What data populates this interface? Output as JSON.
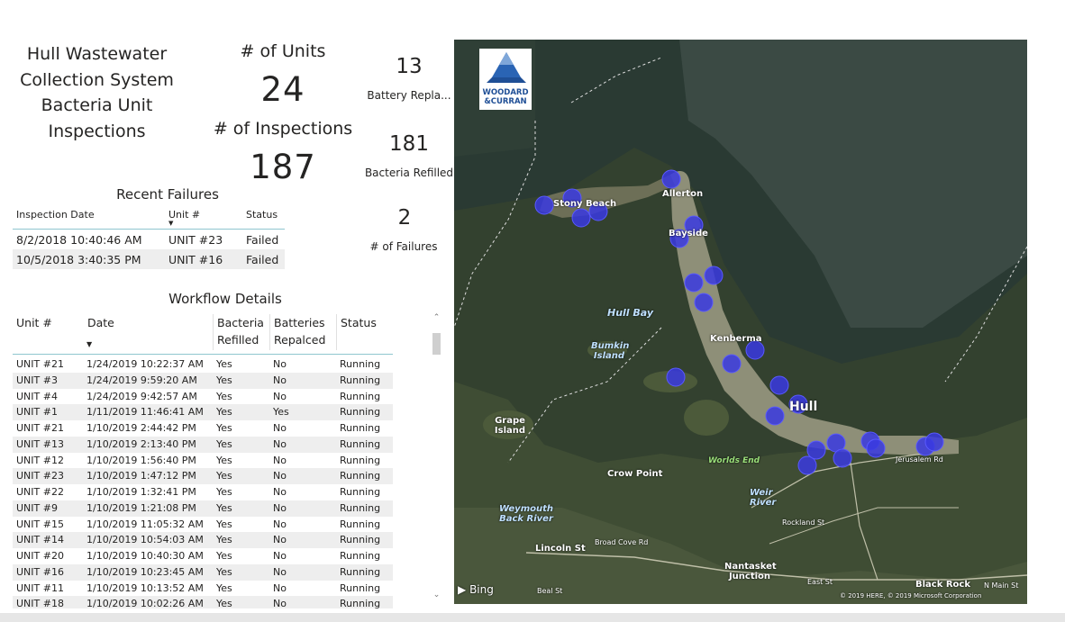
{
  "header": {
    "title": "Hull Wastewater Collection System Bacteria Unit Inspections"
  },
  "cards": {
    "units_label": "# of Units",
    "units_value": "24",
    "inspections_label": "# of Inspections",
    "inspections_value": "187"
  },
  "kpis": [
    {
      "value": "13",
      "label": "Battery Repla..."
    },
    {
      "value": "181",
      "label": "Bacteria Refilled"
    },
    {
      "value": "2",
      "label": "# of Failures"
    }
  ],
  "recent_failures": {
    "title": "Recent Failures",
    "columns": [
      "Inspection Date",
      "Unit #",
      "Status"
    ],
    "rows": [
      [
        "8/2/2018 10:40:46 AM",
        "UNIT #23",
        "Failed"
      ],
      [
        "10/5/2018 3:40:35 PM",
        "UNIT #16",
        "Failed"
      ]
    ]
  },
  "workflow": {
    "title": "Workflow Details",
    "columns": [
      "Unit #",
      "Date",
      "Bacteria Refilled",
      "Batteries Repalced",
      "Status"
    ],
    "rows": [
      [
        "UNIT #21",
        "1/24/2019 10:22:37 AM",
        "Yes",
        "No",
        "Running"
      ],
      [
        "UNIT #3",
        "1/24/2019 9:59:20 AM",
        "Yes",
        "No",
        "Running"
      ],
      [
        "UNIT #4",
        "1/24/2019 9:42:57 AM",
        "Yes",
        "No",
        "Running"
      ],
      [
        "UNIT #1",
        "1/11/2019 11:46:41 AM",
        "Yes",
        "Yes",
        "Running"
      ],
      [
        "UNIT #21",
        "1/10/2019 2:44:42 PM",
        "Yes",
        "No",
        "Running"
      ],
      [
        "UNIT #13",
        "1/10/2019 2:13:40 PM",
        "Yes",
        "No",
        "Running"
      ],
      [
        "UNIT #12",
        "1/10/2019 1:56:40 PM",
        "Yes",
        "No",
        "Running"
      ],
      [
        "UNIT #23",
        "1/10/2019 1:47:12 PM",
        "Yes",
        "No",
        "Running"
      ],
      [
        "UNIT #22",
        "1/10/2019 1:32:41 PM",
        "Yes",
        "No",
        "Running"
      ],
      [
        "UNIT #9",
        "1/10/2019 1:21:08 PM",
        "Yes",
        "No",
        "Running"
      ],
      [
        "UNIT #15",
        "1/10/2019 11:05:32 AM",
        "Yes",
        "No",
        "Running"
      ],
      [
        "UNIT #14",
        "1/10/2019 10:54:03 AM",
        "Yes",
        "No",
        "Running"
      ],
      [
        "UNIT #20",
        "1/10/2019 10:40:30 AM",
        "Yes",
        "No",
        "Running"
      ],
      [
        "UNIT #16",
        "1/10/2019 10:23:45 AM",
        "Yes",
        "No",
        "Running"
      ],
      [
        "UNIT #11",
        "1/10/2019 10:13:52 AM",
        "Yes",
        "No",
        "Running"
      ],
      [
        "UNIT #18",
        "1/10/2019 10:02:26 AM",
        "Yes",
        "No",
        "Running"
      ]
    ]
  },
  "map": {
    "logo_line1": "WOODARD",
    "logo_line2": "&CURRAN",
    "provider": "Bing",
    "copyright": "© 2019 HERE, © 2019 Microsoft Corporation",
    "labels": [
      "Allerton",
      "Stony Beach",
      "Bayside",
      "Hull Bay",
      "Bumkin Island",
      "Kenberma",
      "Hull",
      "Grape Island",
      "Crow Point",
      "Worlds End",
      "Weir River",
      "Weymouth Back River",
      "Lincoln St",
      "Broad Cove Rd",
      "Nantasket Junction",
      "Rockland St",
      "Black Rock",
      "Jerusalem Rd",
      "N Main St",
      "Beal St",
      "East St"
    ],
    "marker_color": "#3a3ae0"
  }
}
